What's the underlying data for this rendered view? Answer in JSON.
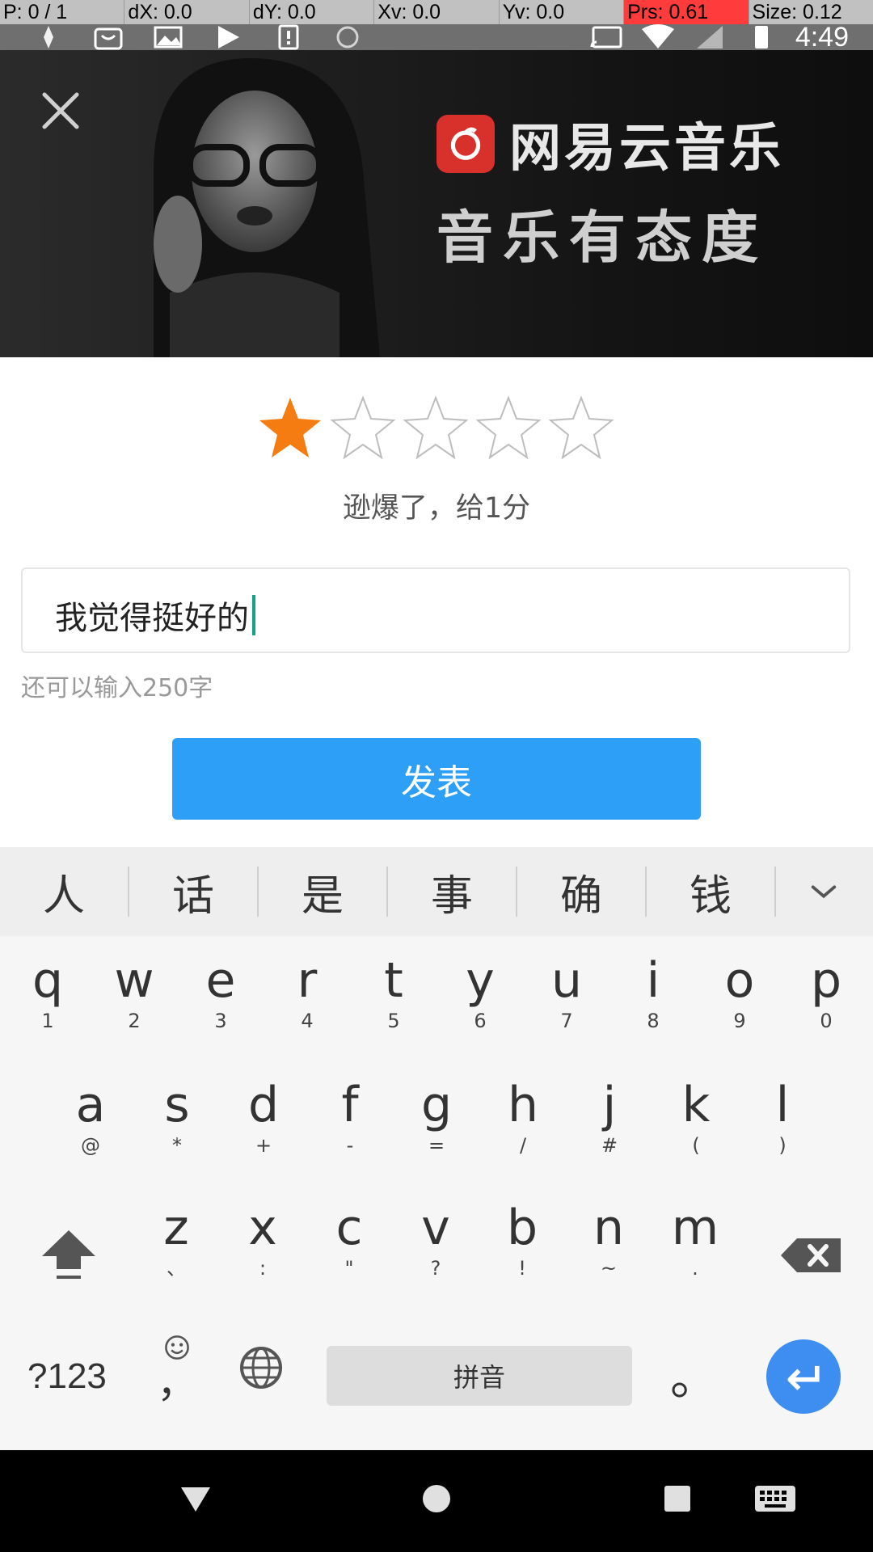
{
  "debug": {
    "p": "P: 0 / 1",
    "dx": "dX: 0.0",
    "dy": "dY: 0.0",
    "xv": "Xv: 0.0",
    "yv": "Yv: 0.0",
    "prs": "Prs: 0.61",
    "size": "Size: 0.12"
  },
  "status": {
    "time": "4:49"
  },
  "banner": {
    "brand_name": "网易云音乐",
    "slogan": "音乐有态度"
  },
  "rating": {
    "value": 1,
    "max": 5,
    "text": "逊爆了，给1分",
    "active_color": "#f47c10"
  },
  "comment": {
    "text": "我觉得挺好的",
    "counter": "还可以输入250字"
  },
  "publish_label": "发表",
  "keyboard": {
    "candidates": [
      "人",
      "话",
      "是",
      "事",
      "确",
      "钱"
    ],
    "row1": [
      {
        "k": "q",
        "s": "1"
      },
      {
        "k": "w",
        "s": "2"
      },
      {
        "k": "e",
        "s": "3"
      },
      {
        "k": "r",
        "s": "4"
      },
      {
        "k": "t",
        "s": "5"
      },
      {
        "k": "y",
        "s": "6"
      },
      {
        "k": "u",
        "s": "7"
      },
      {
        "k": "i",
        "s": "8"
      },
      {
        "k": "o",
        "s": "9"
      },
      {
        "k": "p",
        "s": "0"
      }
    ],
    "row2": [
      {
        "k": "a",
        "s": "@"
      },
      {
        "k": "s",
        "s": "*"
      },
      {
        "k": "d",
        "s": "+"
      },
      {
        "k": "f",
        "s": "-"
      },
      {
        "k": "g",
        "s": "="
      },
      {
        "k": "h",
        "s": "/"
      },
      {
        "k": "j",
        "s": "#"
      },
      {
        "k": "k",
        "s": "("
      },
      {
        "k": "l",
        "s": ")"
      }
    ],
    "row3": [
      {
        "k": "z",
        "s": "、"
      },
      {
        "k": "x",
        "s": ":"
      },
      {
        "k": "c",
        "s": "\""
      },
      {
        "k": "v",
        "s": "?"
      },
      {
        "k": "b",
        "s": "!"
      },
      {
        "k": "n",
        "s": "~"
      },
      {
        "k": "m",
        "s": "."
      }
    ],
    "symbols_label": "?123",
    "comma_label": "，",
    "space_label": "拼音",
    "period_label": "。"
  }
}
